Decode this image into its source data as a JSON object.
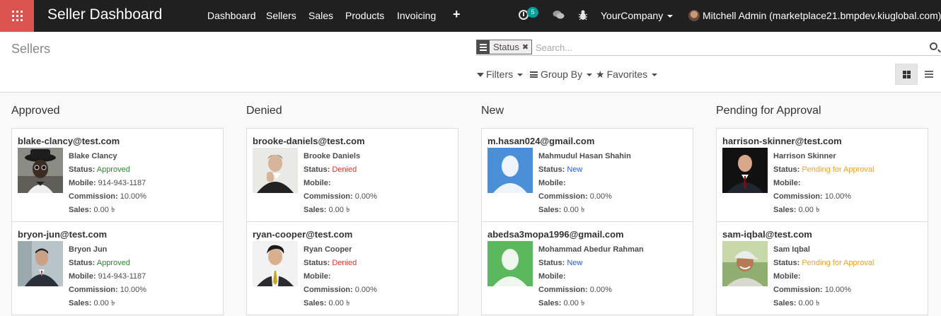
{
  "navbar": {
    "title": "Seller Dashboard",
    "menu": [
      "Dashboard",
      "Sellers",
      "Sales",
      "Products",
      "Invoicing"
    ],
    "activity_count": "5",
    "company": "YourCompany",
    "user": "Mitchell Admin (marketplace21.bmpdev.kiuglobal.com)"
  },
  "control_panel": {
    "breadcrumb": "Sellers",
    "facet_label": "Status",
    "search_placeholder": "Search...",
    "filters_label": "Filters",
    "groupby_label": "Group By",
    "favorites_label": "Favorites"
  },
  "labels": {
    "status": "Status:",
    "mobile": "Mobile:",
    "commission": "Commission:",
    "sales": "Sales:"
  },
  "colors": {
    "navbar_bg": "#202020",
    "apps_button": "#d9534f",
    "badge": "#00a09d",
    "approved": "#2a8a2a",
    "denied": "#d9342b",
    "new": "#2b5bd9",
    "pending": "#f0a030"
  },
  "columns": [
    {
      "title": "Approved",
      "cards": [
        {
          "email": "blake-clancy@test.com",
          "name": "Blake Clancy",
          "status": "Approved",
          "mobile": "914-943-1187",
          "commission": "10.00%",
          "sales": "0.00 ৳",
          "avatar": "person-hat-photo"
        },
        {
          "email": "bryon-jun@test.com",
          "name": "Bryon Jun",
          "status": "Approved",
          "mobile": "914-943-1187",
          "commission": "10.00%",
          "sales": "0.00 ৳",
          "avatar": "person-suit-photo"
        }
      ]
    },
    {
      "title": "Denied",
      "cards": [
        {
          "email": "brooke-daniels@test.com",
          "name": "Brooke Daniels",
          "status": "Denied",
          "mobile": "",
          "commission": "0.00%",
          "sales": "0.00 ৳",
          "avatar": "person-thinking-photo"
        },
        {
          "email": "ryan-cooper@test.com",
          "name": "Ryan Cooper",
          "status": "Denied",
          "mobile": "",
          "commission": "0.00%",
          "sales": "0.00 ৳",
          "avatar": "person-tie-photo"
        }
      ]
    },
    {
      "title": "New",
      "cards": [
        {
          "email": "m.hasan024@gmail.com",
          "name": "Mahmudul Hasan Shahin",
          "status": "New",
          "mobile": "",
          "commission": "0.00%",
          "sales": "0.00 ৳",
          "avatar": "placeholder-blue-avatar"
        },
        {
          "email": "abedsa3mopa1996@gmail.com",
          "name": "Mohammad Abedur Rahman",
          "status": "New",
          "mobile": "",
          "commission": "0.00%",
          "sales": "0.00 ৳",
          "avatar": "placeholder-green-avatar"
        }
      ]
    },
    {
      "title": "Pending for Approval",
      "cards": [
        {
          "email": "harrison-skinner@test.com",
          "name": "Harrison Skinner",
          "status": "Pending for Approval",
          "mobile": "",
          "commission": "10.00%",
          "sales": "0.00 ৳",
          "avatar": "person-suit-dark-photo"
        },
        {
          "email": "sam-iqbal@test.com",
          "name": "Sam Iqbal",
          "status": "Pending for Approval",
          "mobile": "",
          "commission": "10.00%",
          "sales": "0.00 ৳",
          "avatar": "person-cap-photo"
        }
      ]
    }
  ]
}
